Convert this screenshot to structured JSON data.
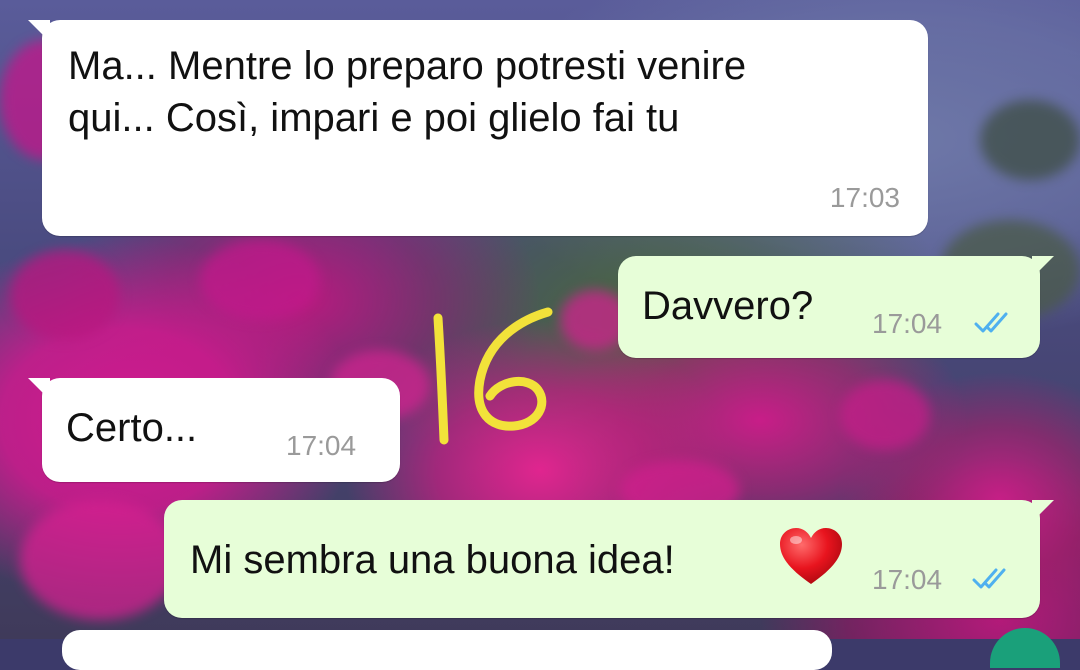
{
  "messages": [
    {
      "direction": "incoming",
      "text": "Ma... Mentre lo preparo potresti venire\nqui... Così, impari e poi glielo fai tu",
      "time": "17:03"
    },
    {
      "direction": "outgoing",
      "text": "Davvero?",
      "time": "17:04",
      "status_icon": "double-check-read-icon"
    },
    {
      "direction": "incoming",
      "text": "Certo...",
      "time": "17:04"
    },
    {
      "direction": "outgoing",
      "text": "Mi sembra una buona idea!",
      "emoji": "heart-emoji-icon",
      "time": "17:04",
      "status_icon": "double-check-read-icon"
    }
  ],
  "overlay": {
    "handwritten_number": "16",
    "color": "#f2e23a"
  },
  "colors": {
    "incoming_bubble": "#ffffff",
    "outgoing_bubble": "#e7fed8",
    "timestamp": "#9a9a9a",
    "read_ticks": "#4fb0ef",
    "fab": "#1aa07a"
  }
}
